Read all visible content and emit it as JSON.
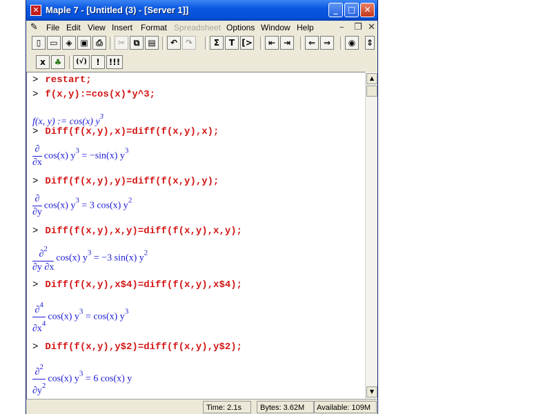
{
  "window": {
    "title": "Maple 7  - [Untitled (3) - [Server 1]]"
  },
  "menu": [
    {
      "label": "File",
      "disabled": false
    },
    {
      "label": "Edit",
      "disabled": false
    },
    {
      "label": "View",
      "disabled": false
    },
    {
      "label": "Insert",
      "disabled": false
    },
    {
      "label": "Format",
      "disabled": false
    },
    {
      "label": "Spreadsheet",
      "disabled": true
    },
    {
      "label": "Options",
      "disabled": false
    },
    {
      "label": "Window",
      "disabled": false
    },
    {
      "label": "Help",
      "disabled": false
    }
  ],
  "toolbar2": {
    "b1": "x",
    "b3": "(√)",
    "b4": "!",
    "b5": "!!!"
  },
  "worksheet": {
    "prompt": ">",
    "in1": "restart;",
    "in2": "f(x,y):=cos(x)*y^3;",
    "out2_lhs": "f(x, y) := cos(x) y",
    "exp3": "3",
    "in3": "Diff(f(x,y),x)=diff(f(x,y),x);",
    "partial": "∂",
    "dx": "∂x",
    "dy": "∂y",
    "dydx": "∂y ∂x",
    "exp2": "2",
    "exp4": "4",
    "term": "cos(x) y",
    "out3_rhs": "= −sin(x) y",
    "in4": "Diff(f(x,y),y)=diff(f(x,y),y);",
    "out4_rhs": "= 3 cos(x) y",
    "in5": "Diff(f(x,y),x,y)=diff(f(x,y),x,y);",
    "out5_rhs": "= −3 sin(x) y",
    "in6": "Diff(f(x,y),x$4)=diff(f(x,y),x$4);",
    "out6_rhs": "= cos(x) y",
    "in7": "Diff(f(x,y),y$2)=diff(f(x,y),y$2);",
    "out7_rhs": "= 6 cos(x) y"
  },
  "status": {
    "time": "Time:  2.1s",
    "bytes": "Bytes: 3.62M",
    "available": "Available: 109M"
  }
}
